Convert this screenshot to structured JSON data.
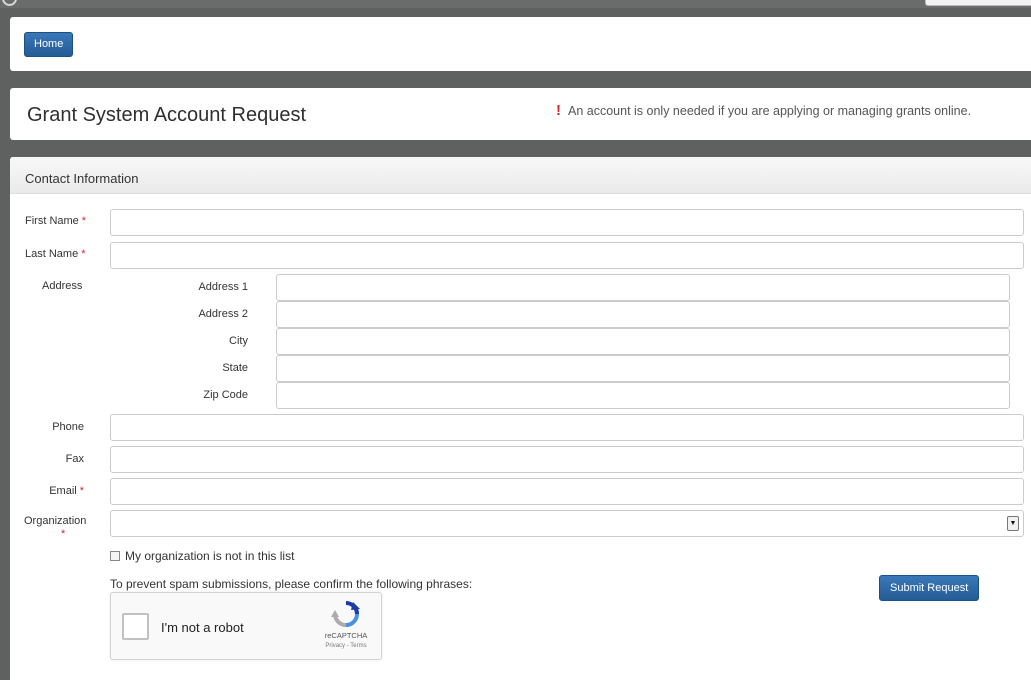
{
  "nav": {
    "home_label": "Home"
  },
  "header": {
    "title": "Grant System Account Request",
    "notice_mark": "!",
    "notice": "An account is only needed if you are applying or managing grants online."
  },
  "section": {
    "title": "Contact Information"
  },
  "fields": {
    "first_name": "First Name",
    "last_name": "Last Name",
    "address": "Address",
    "address1": "Address 1",
    "address2": "Address 2",
    "city": "City",
    "state": "State",
    "zip": "Zip Code",
    "phone": "Phone",
    "fax": "Fax",
    "email": "Email",
    "organization": "Organization",
    "required_mark": "*"
  },
  "organization_select": {
    "selected": ""
  },
  "org_checkbox": {
    "label": "My organization is not in this list",
    "checked": false
  },
  "spam_note": "To prevent spam submissions, please confirm the following phrases:",
  "submit_label": "Submit Request",
  "captcha": {
    "label": "I'm not a robot",
    "brand": "reCAPTCHA",
    "links": "Privacy - Terms"
  },
  "colors": {
    "primary_button": "#2a65a3",
    "required": "#d02a2a",
    "page_background": "#5f6060"
  },
  "icons": {
    "warning": "exclamation-icon",
    "select": "dropdown-arrow-icon",
    "captcha": "recaptcha-logo-icon"
  }
}
